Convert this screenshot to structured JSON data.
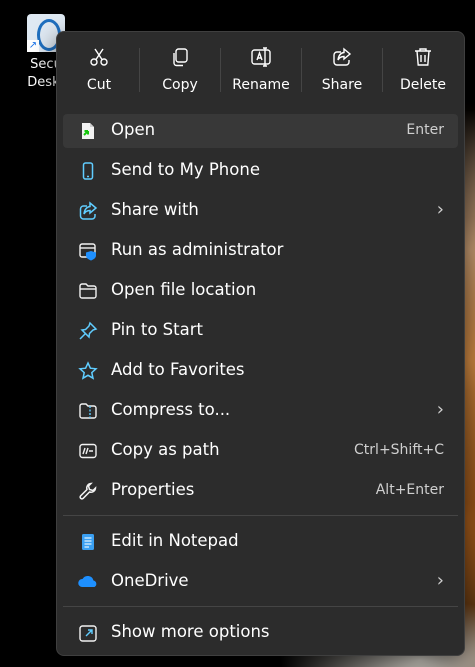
{
  "desktop": {
    "icon_label_line1": "Secu",
    "icon_label_line2": "Deskt"
  },
  "toolbar": {
    "cut": "Cut",
    "copy": "Copy",
    "rename": "Rename",
    "share": "Share",
    "delete": "Delete"
  },
  "items": [
    {
      "label": "Open",
      "shortcut": "Enter",
      "icon": "open-icon"
    },
    {
      "label": "Send to My Phone",
      "icon": "phone-icon"
    },
    {
      "label": "Share with",
      "submenu": true,
      "icon": "share-with-icon"
    },
    {
      "label": "Run as administrator",
      "icon": "shield-icon"
    },
    {
      "label": "Open file location",
      "icon": "folder-icon"
    },
    {
      "label": "Pin to Start",
      "icon": "pin-icon"
    },
    {
      "label": "Add to Favorites",
      "icon": "star-icon"
    },
    {
      "label": "Compress to...",
      "submenu": true,
      "icon": "zip-folder-icon"
    },
    {
      "label": "Copy as path",
      "shortcut": "Ctrl+Shift+C",
      "icon": "copy-path-icon"
    },
    {
      "label": "Properties",
      "shortcut": "Alt+Enter",
      "icon": "wrench-icon"
    },
    {
      "label": "Edit in Notepad",
      "icon": "notepad-icon"
    },
    {
      "label": "OneDrive",
      "submenu": true,
      "icon": "onedrive-icon"
    },
    {
      "label": "Show more options",
      "icon": "more-options-icon"
    }
  ],
  "colors": {
    "menu_bg": "#2c2c2c",
    "hover_bg": "#383838",
    "accent": "#60cdff"
  }
}
